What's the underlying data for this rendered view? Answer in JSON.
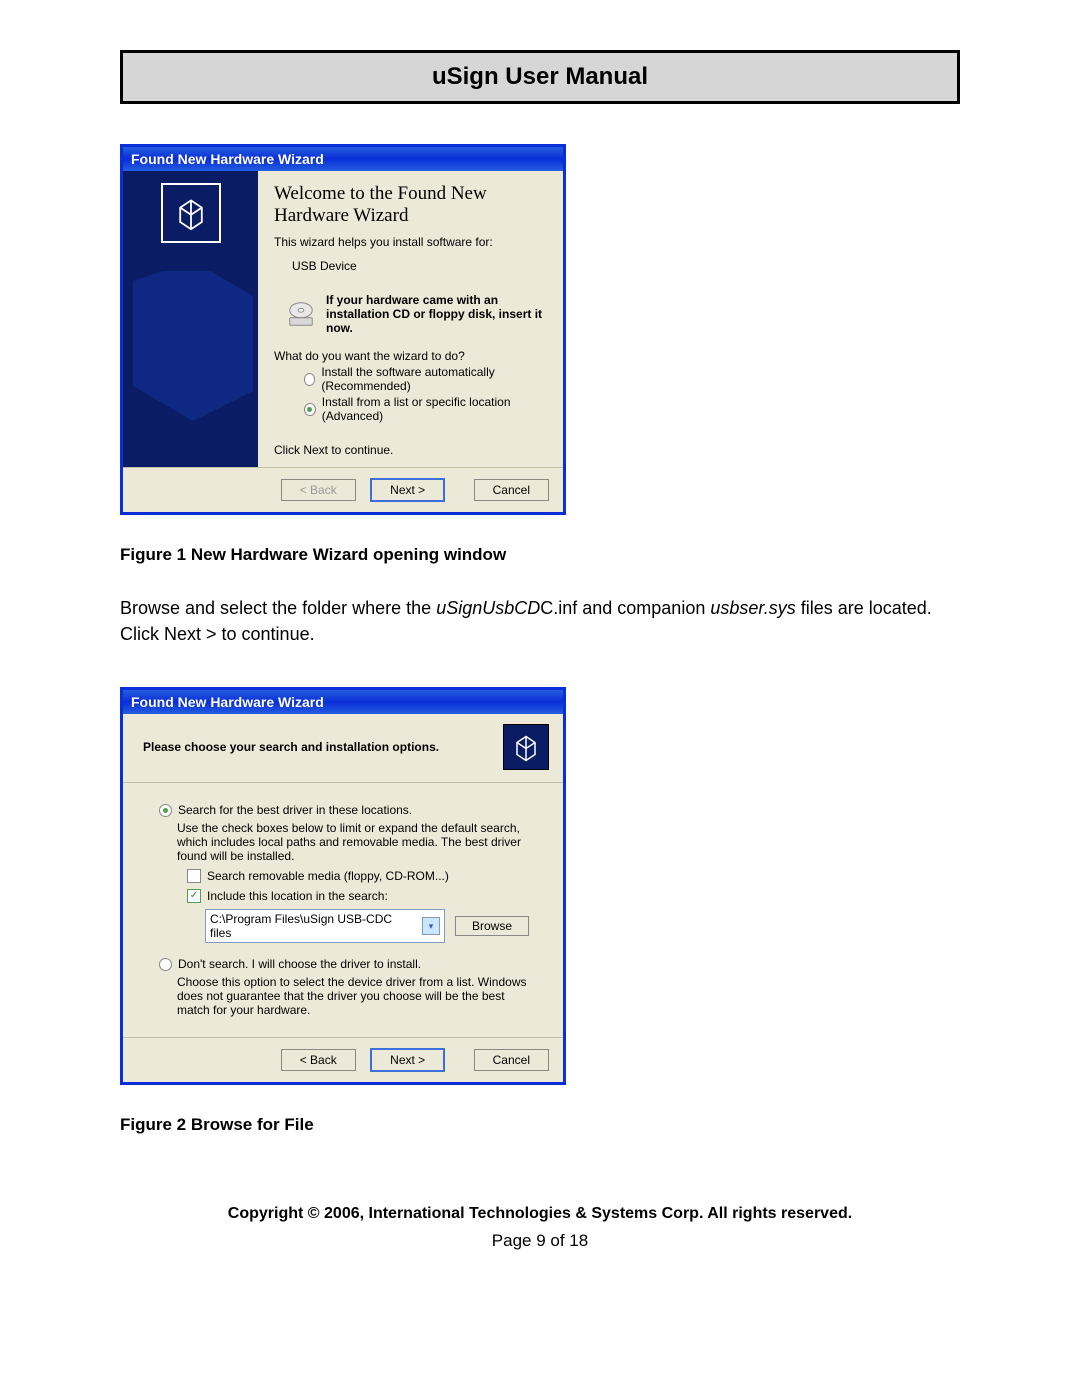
{
  "header_title": "uSign User Manual",
  "wizard1": {
    "titlebar": "Found New Hardware Wizard",
    "welcome_title": "Welcome to the Found New Hardware Wizard",
    "intro_line": "This wizard helps you install software for:",
    "device_name": "USB Device",
    "cd_prompt": "If your hardware came with an installation CD or floppy disk, insert it now.",
    "question": "What do you want the wizard to do?",
    "option_auto": "Install the software automatically (Recommended)",
    "option_list": "Install from a list or specific location (Advanced)",
    "continue_text": "Click Next to continue.",
    "back_btn": "< Back",
    "next_btn": "Next >",
    "cancel_btn": "Cancel"
  },
  "caption1": "Figure 1   New Hardware Wizard opening window",
  "paragraph": {
    "pre": "Browse and select the folder where the ",
    "file1": "uSignUsbCD",
    "mid": "C.inf and companion ",
    "file2": "usbser.sys",
    "post": " files are located.  Click Next > to continue."
  },
  "wizard2": {
    "titlebar": "Found New Hardware Wizard",
    "header": "Please choose your search and installation options.",
    "opt_search": "Search for the best driver in these locations.",
    "search_help": "Use the check boxes below to limit or expand the default search, which includes local paths and removable media. The best driver found will be installed.",
    "chk_removable": "Search removable media (floppy, CD-ROM...)",
    "chk_include": "Include this location in the search:",
    "path_value": "C:\\Program Files\\uSign USB-CDC files",
    "browse_btn": "Browse",
    "opt_dont": "Don't search. I will choose the driver to install.",
    "dont_help": "Choose this option to select the device driver from a list.  Windows does not guarantee that the driver you choose will be the best match for your hardware.",
    "back_btn": "< Back",
    "next_btn": "Next >",
    "cancel_btn": "Cancel"
  },
  "caption2": "Figure 2   Browse for File",
  "footer": {
    "copyright": "Copyright © 2006, International Technologies & Systems Corp. All rights reserved.",
    "page": "Page 9 of 18"
  }
}
